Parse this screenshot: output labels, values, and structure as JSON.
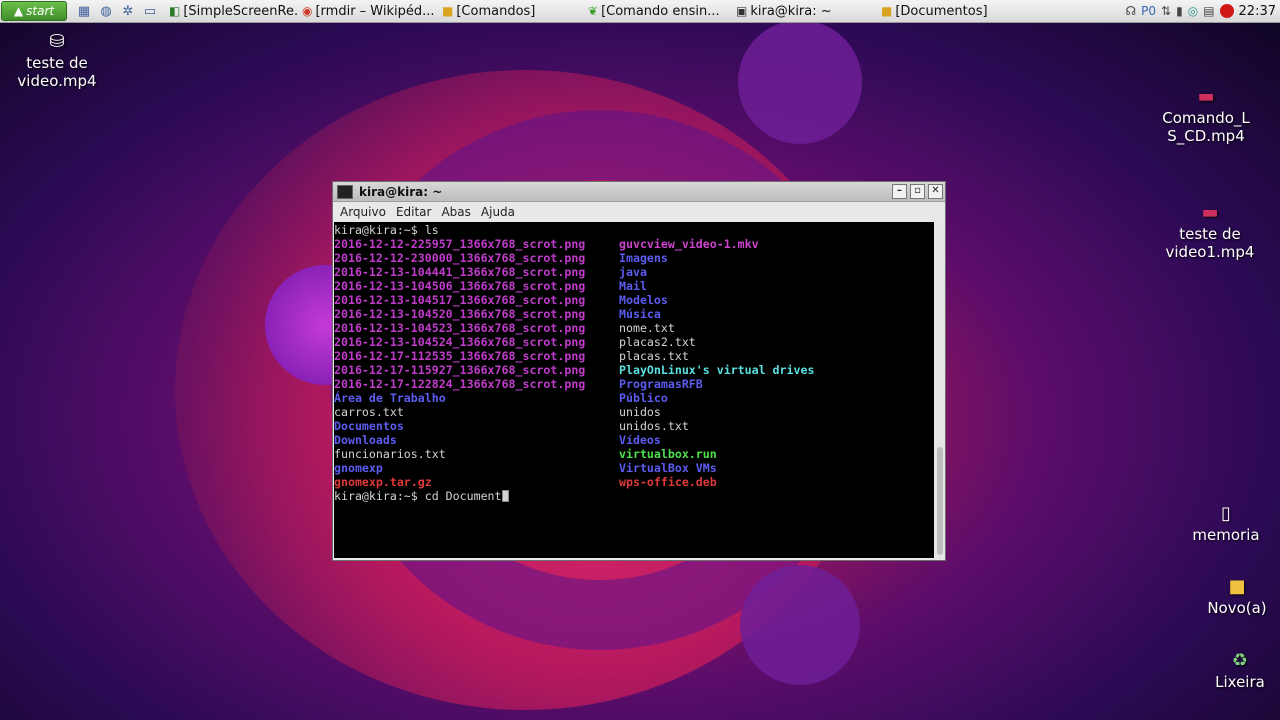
{
  "taskbar": {
    "start_label": "start",
    "tasks": [
      {
        "icon": "screen-recorder-icon",
        "label": "[SimpleScreenRe..."
      },
      {
        "icon": "chrome-icon",
        "label": "[rmdir – Wikipéd..."
      },
      {
        "icon": "folder-icon",
        "label": "[Comandos]"
      },
      {
        "icon": "leaf-icon",
        "label": "[Comando ensin..."
      },
      {
        "icon": "terminal-icon",
        "label": "kira@kira: ~"
      },
      {
        "icon": "folder-icon",
        "label": "[Documentos]"
      }
    ],
    "tray_p0": "P0",
    "clock": "22:37"
  },
  "desktop_icons": [
    {
      "label": "teste de\nvideo.mp4"
    },
    {
      "label": "Comando_L\nS_CD.mp4"
    },
    {
      "label": "teste de\nvideo1.mp4"
    },
    {
      "label": "memoria"
    },
    {
      "label": "Novo(a)"
    },
    {
      "label": "Lixeira"
    }
  ],
  "terminal": {
    "title": "kira@kira: ~",
    "menu": [
      "Arquivo",
      "Editar",
      "Abas",
      "Ajuda"
    ],
    "prompt1": "kira@kira:~$ ls",
    "rows": [
      {
        "left": "2016-12-12-225957_1366x768_scrot.png",
        "left_type": "png",
        "right": "guvcview_video-1.mkv",
        "right_type": "pink"
      },
      {
        "left": "2016-12-12-230000_1366x768_scrot.png",
        "left_type": "png",
        "right": "Imagens",
        "right_type": "dir"
      },
      {
        "left": "2016-12-13-104441_1366x768_scrot.png",
        "left_type": "png",
        "right": "java",
        "right_type": "dir"
      },
      {
        "left": "2016-12-13-104506_1366x768_scrot.png",
        "left_type": "png",
        "right": "Mail",
        "right_type": "dir"
      },
      {
        "left": "2016-12-13-104517_1366x768_scrot.png",
        "left_type": "png",
        "right": "Modelos",
        "right_type": "dir"
      },
      {
        "left": "2016-12-13-104520_1366x768_scrot.png",
        "left_type": "png",
        "right": "Música",
        "right_type": "dir"
      },
      {
        "left": "2016-12-13-104523_1366x768_scrot.png",
        "left_type": "png",
        "right": "nome.txt",
        "right_type": "file"
      },
      {
        "left": "2016-12-13-104524_1366x768_scrot.png",
        "left_type": "png",
        "right": "placas2.txt",
        "right_type": "file"
      },
      {
        "left": "2016-12-17-112535_1366x768_scrot.png",
        "left_type": "png",
        "right": "placas.txt",
        "right_type": "file"
      },
      {
        "left": "2016-12-17-115927_1366x768_scrot.png",
        "left_type": "png",
        "right": "PlayOnLinux's virtual drives",
        "right_type": "sticky"
      },
      {
        "left": "2016-12-17-122824_1366x768_scrot.png",
        "left_type": "png",
        "right": "ProgramasRFB",
        "right_type": "dir"
      },
      {
        "left": "Área de Trabalho",
        "left_type": "dir",
        "right": "Público",
        "right_type": "dir"
      },
      {
        "left": "carros.txt",
        "left_type": "file",
        "right": "unidos",
        "right_type": "file"
      },
      {
        "left": "Documentos",
        "left_type": "dir",
        "right": "unidos.txt",
        "right_type": "file"
      },
      {
        "left": "Downloads",
        "left_type": "dir",
        "right": "Vídeos",
        "right_type": "dir"
      },
      {
        "left": "funcionarios.txt",
        "left_type": "file",
        "right": "virtualbox.run",
        "right_type": "exe"
      },
      {
        "left": "gnomexp",
        "left_type": "dir",
        "right": "VirtualBox VMs",
        "right_type": "dir"
      },
      {
        "left": "gnomexp.tar.gz",
        "left_type": "arc",
        "right": "wps-office.deb",
        "right_type": "arc"
      }
    ],
    "prompt2": "kira@kira:~$ cd Document"
  }
}
